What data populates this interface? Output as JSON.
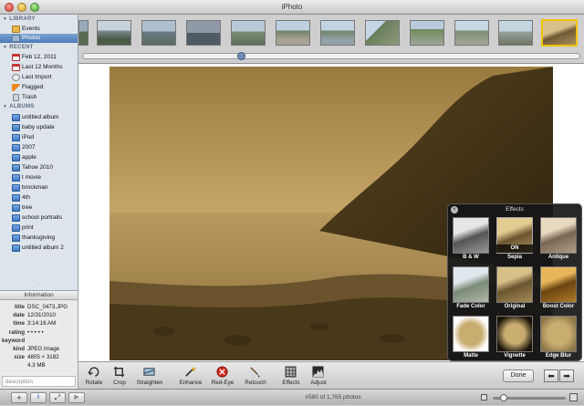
{
  "window": {
    "title": "iPhoto"
  },
  "sidebar": {
    "library_heading": "LIBRARY",
    "library_items": [
      {
        "label": "Events",
        "icon": "events-icon"
      },
      {
        "label": "Photos",
        "icon": "photos-icon",
        "selected": true
      }
    ],
    "recent_heading": "RECENT",
    "recent_items": [
      {
        "label": "Feb 12, 2011",
        "icon": "calendar-icon"
      },
      {
        "label": "Last 12 Months",
        "icon": "calendar-icon"
      },
      {
        "label": "Last Import",
        "icon": "clock-icon"
      },
      {
        "label": "Flagged",
        "icon": "flag-icon"
      },
      {
        "label": "Trash",
        "icon": "trash-icon"
      }
    ],
    "albums_heading": "ALBUMS",
    "albums": [
      "untitled album",
      "baby update",
      "iPod",
      "2007",
      "apple",
      "Tahoe 2010",
      "t movie",
      "brockman",
      "4th",
      "tree",
      "school portraits",
      "print",
      "thanksgiving",
      "untitled album 2"
    ]
  },
  "info": {
    "heading": "Information",
    "title_label": "title",
    "title_value": "DSC_0473.JPG",
    "date_label": "date",
    "date_value": "12/31/2010",
    "time_label": "time",
    "time_value": "3:14:16 AM",
    "rating_label": "rating",
    "rating_value": "• • • • •",
    "keyword_label": "keyword",
    "kind_label": "kind",
    "kind_value": "JPEG Image",
    "size_label": "size",
    "size_value": "4805 × 3182",
    "filesize_value": "4.3 MB",
    "description_placeholder": "description"
  },
  "effects": {
    "title": "Effects",
    "items": [
      {
        "label": "B & W",
        "on": false
      },
      {
        "label": "Sepia",
        "on": true,
        "on_label": "ON"
      },
      {
        "label": "Antique",
        "on": false
      },
      {
        "label": "Fade Color",
        "on": false
      },
      {
        "label": "Original",
        "on": false
      },
      {
        "label": "Boost Color",
        "on": false
      },
      {
        "label": "Matte",
        "on": false
      },
      {
        "label": "Vignette",
        "on": false
      },
      {
        "label": "Edge Blur",
        "on": false
      }
    ]
  },
  "toolbar": {
    "tools": [
      {
        "label": "Rotate",
        "icon": "rotate-icon"
      },
      {
        "label": "Crop",
        "icon": "crop-icon"
      },
      {
        "label": "Straighten",
        "icon": "straighten-icon"
      },
      {
        "label": "Enhance",
        "icon": "magic-wand-icon"
      },
      {
        "label": "Red-Eye",
        "icon": "red-eye-icon"
      },
      {
        "label": "Retouch",
        "icon": "retouch-brush-icon"
      },
      {
        "label": "Effects",
        "icon": "effects-grid-icon"
      },
      {
        "label": "Adjust",
        "icon": "adjust-histogram-icon"
      }
    ],
    "done_label": "Done",
    "prev_arrow": "⬅",
    "next_arrow": "➡"
  },
  "statusbar": {
    "photo_count": "#580 of 1,765 photos",
    "add_symbol": "+",
    "info_symbol": "i",
    "fullscreen_symbol": "⤢",
    "play_symbol": "▶"
  },
  "colors": {
    "selection": "#4c7bb6",
    "sepia": "#b08a4a",
    "active_thumb_border": "#f0c400"
  }
}
